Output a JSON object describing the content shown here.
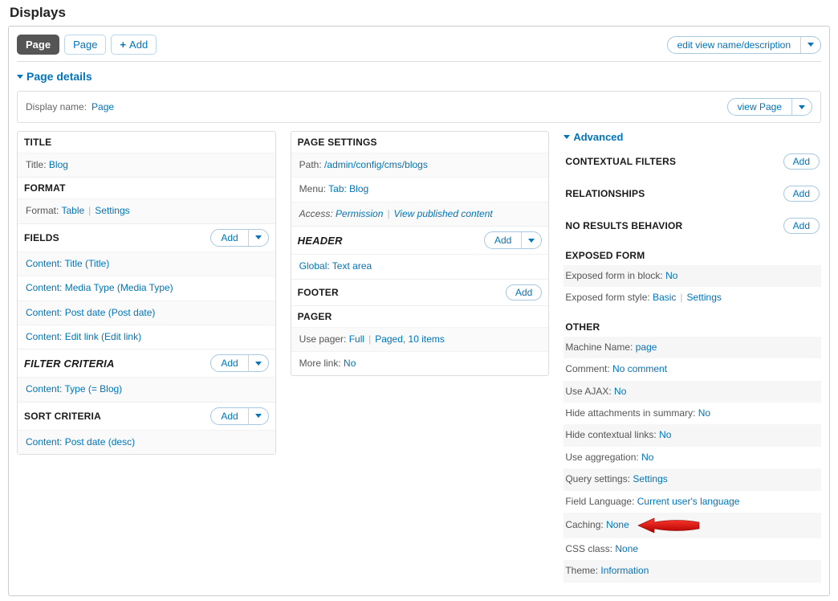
{
  "heading": "Displays",
  "tabs": {
    "active": "Page",
    "second": "Page",
    "add": "Add"
  },
  "edit_view_btn": "edit view name/description",
  "page_details_toggle": "Page details",
  "display_name": {
    "label": "Display name:",
    "value": "Page"
  },
  "view_page_btn": "view Page",
  "left": {
    "title": {
      "head": "TITLE",
      "label": "Title:",
      "value": "Blog"
    },
    "format": {
      "head": "FORMAT",
      "label": "Format:",
      "value": "Table",
      "settings": "Settings"
    },
    "fields": {
      "head": "FIELDS",
      "add": "Add",
      "items": [
        "Content: Title (Title)",
        "Content: Media Type (Media Type)",
        "Content: Post date (Post date)",
        "Content: Edit link (Edit link)"
      ]
    },
    "filter": {
      "head": "FILTER CRITERIA",
      "add": "Add",
      "items": [
        "Content: Type (= Blog)"
      ]
    },
    "sort": {
      "head": "SORT CRITERIA",
      "add": "Add",
      "items": [
        "Content: Post date (desc)"
      ]
    }
  },
  "mid": {
    "page_settings": {
      "head": "PAGE SETTINGS",
      "path": {
        "label": "Path:",
        "parts": [
          "/",
          "admin",
          "/",
          "config",
          "/",
          "cms",
          "/",
          "blogs"
        ]
      },
      "menu": {
        "label": "Menu:",
        "value": "Tab: Blog"
      },
      "access": {
        "label": "Access:",
        "value1": "Permission",
        "value2": "View published content"
      }
    },
    "header": {
      "head": "HEADER",
      "add": "Add",
      "items": [
        "Global: Text area"
      ]
    },
    "footer": {
      "head": "FOOTER",
      "add": "Add"
    },
    "pager": {
      "head": "PAGER",
      "use": {
        "label": "Use pager:",
        "value1": "Full",
        "value2": "Paged, 10 items"
      },
      "more": {
        "label": "More link:",
        "value": "No"
      }
    }
  },
  "right": {
    "advanced_toggle": "Advanced",
    "contextual": {
      "head": "CONTEXTUAL FILTERS",
      "add": "Add"
    },
    "relationships": {
      "head": "RELATIONSHIPS",
      "add": "Add"
    },
    "noresults": {
      "head": "NO RESULTS BEHAVIOR",
      "add": "Add"
    },
    "exposed": {
      "head": "EXPOSED FORM",
      "block": {
        "label": "Exposed form in block:",
        "value": "No"
      },
      "style": {
        "label": "Exposed form style:",
        "value": "Basic",
        "settings": "Settings"
      }
    },
    "other": {
      "head": "OTHER",
      "rows": {
        "machine": {
          "label": "Machine Name:",
          "value": "page"
        },
        "comment": {
          "label": "Comment:",
          "value": "No comment"
        },
        "ajax": {
          "label": "Use AJAX:",
          "value": "No"
        },
        "hide_attach": {
          "label": "Hide attachments in summary:",
          "value": "No"
        },
        "hide_ctx": {
          "label": "Hide contextual links:",
          "value": "No"
        },
        "aggregation": {
          "label": "Use aggregation:",
          "value": "No"
        },
        "query": {
          "label": "Query settings:",
          "value": "Settings"
        },
        "field_lang": {
          "label": "Field Language:",
          "value": "Current user's language"
        },
        "caching": {
          "label": "Caching:",
          "value": "None"
        },
        "css": {
          "label": "CSS class:",
          "value": "None"
        },
        "theme": {
          "label": "Theme:",
          "value": "Information"
        }
      }
    }
  }
}
